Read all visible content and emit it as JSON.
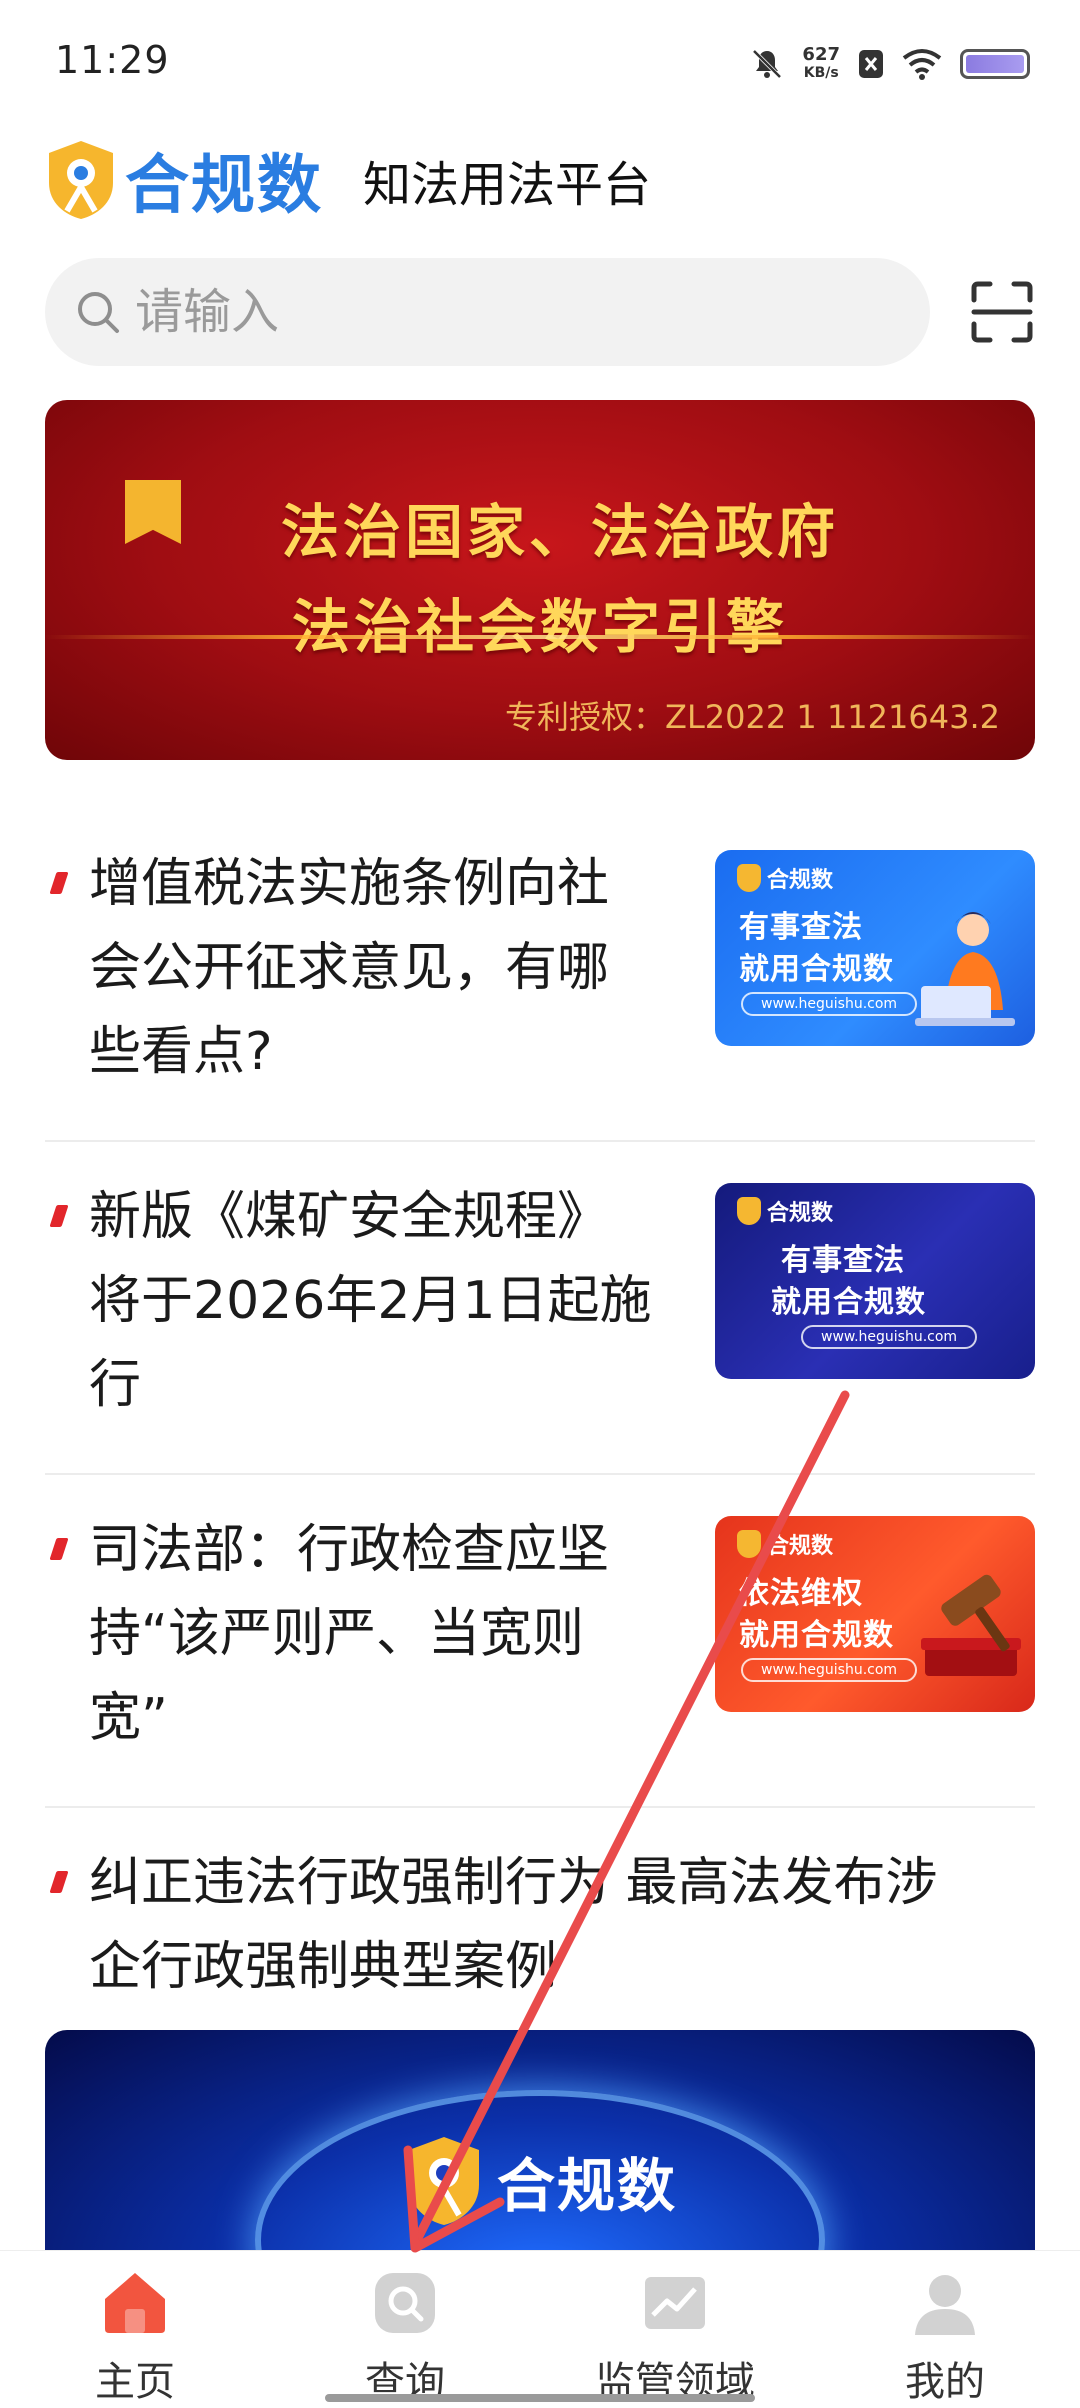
{
  "status_bar": {
    "time": "11:29",
    "net_speed_value": "627",
    "net_speed_unit": "KB/s",
    "icons": [
      "mute-icon",
      "sim-icon",
      "wifi-icon",
      "battery-icon"
    ]
  },
  "header": {
    "brand": "合规数",
    "slogan": "知法用法平台"
  },
  "search": {
    "placeholder": "请输入"
  },
  "banner": {
    "line1": "法治国家、法治政府",
    "line2": "法治社会数字引擎",
    "patent": "专利授权：ZL2022 1 1121643.2",
    "colors": {
      "background": "#b01015",
      "text": "#ffd75a"
    }
  },
  "news": [
    {
      "title_lines": [
        "增值税法实施条例向社",
        "会公开征求意见，有哪",
        "些看点?"
      ],
      "thumb": {
        "brand": "合规数",
        "line1": "有事查法",
        "line2": "就用合规数",
        "url": "www.heguishu.com",
        "style": "blue"
      }
    },
    {
      "title_lines": [
        "新版《煤矿安全规程》",
        "将于2026年2月1日起施",
        "行"
      ],
      "thumb": {
        "brand": "合规数",
        "line1": "有事查法",
        "line2": "就用合规数",
        "url": "www.heguishu.com",
        "style": "navy"
      }
    },
    {
      "title_lines": [
        "司法部：行政检查应坚",
        "持“该严则严、当宽则",
        "宽”"
      ],
      "thumb": {
        "brand": "合规数",
        "line1": "依法维权",
        "line2": "就用合规数",
        "url": "www.heguishu.com",
        "style": "red"
      }
    },
    {
      "title_lines": [
        "纠正违法行政强制行为 最高法发布涉",
        "企行政强制典型案例"
      ]
    }
  ],
  "bottom_banner": {
    "brand": "合规数"
  },
  "tab_bar": {
    "tabs": [
      {
        "label": "主页",
        "icon": "home-icon",
        "active": true
      },
      {
        "label": "查询",
        "icon": "search-tab-icon",
        "active": false
      },
      {
        "label": "监管领域",
        "icon": "chart-icon",
        "active": false
      },
      {
        "label": "我的",
        "icon": "profile-icon",
        "active": false
      }
    ],
    "active_color": "#f2553f",
    "inactive_color": "#cfcfcf"
  },
  "annotation": {
    "arrow_color": "#e94b4b"
  }
}
